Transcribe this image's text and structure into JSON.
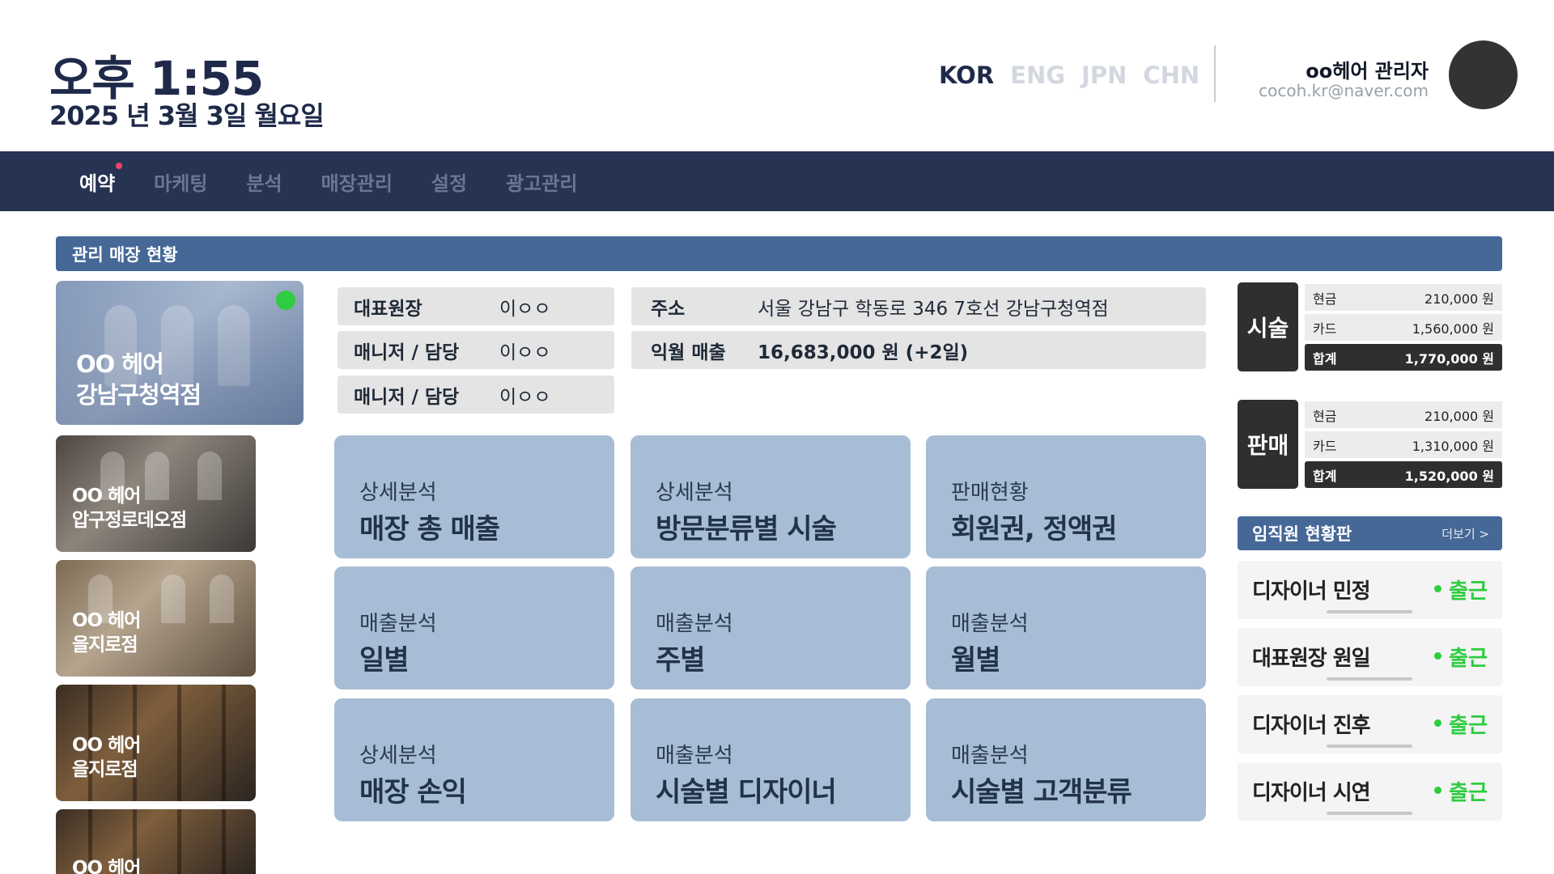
{
  "header": {
    "time": "오후 1:55",
    "date": "2025 년 3월 3일  월요일",
    "languages": [
      "KOR",
      "ENG",
      "JPN",
      "CHN"
    ],
    "admin_name": "oo헤어 관리자",
    "admin_email": "cocoh.kr@naver.com"
  },
  "nav": {
    "items": [
      "예약",
      "마케팅",
      "분석",
      "매장관리",
      "설정",
      "광고관리"
    ]
  },
  "section": {
    "title": "관리 매장 현황"
  },
  "stores": [
    {
      "line1": "OO 헤어",
      "line2": "강남구청역점"
    },
    {
      "line1": "OO 헤어",
      "line2": "압구정로데오점"
    },
    {
      "line1": "OO 헤어",
      "line2": "을지로점"
    },
    {
      "line1": "OO 헤어",
      "line2": "을지로점"
    },
    {
      "line1": "OO 헤어",
      "line2": ""
    }
  ],
  "info": {
    "rep_label": "대표원장",
    "rep_value": "이ㅇㅇ",
    "mgr1_label": "매니저 / 담당",
    "mgr1_value": "이ㅇㅇ",
    "mgr2_label": "매니저 / 담당",
    "mgr2_value": "이ㅇㅇ",
    "addr_label": "주소",
    "addr_value": "서울 강남구 학동로 346 7호선 강남구청역점",
    "sales_label": "익월 매출",
    "sales_value": "16,683,000 원 (+2일)"
  },
  "tiles": [
    {
      "sub": "상세분석",
      "main": "매장 총 매출"
    },
    {
      "sub": "상세분석",
      "main": "방문분류별 시술"
    },
    {
      "sub": "판매현황",
      "main": "회원권, 정액권"
    },
    {
      "sub": "매출분석",
      "main": "일별"
    },
    {
      "sub": "매출분석",
      "main": "주별"
    },
    {
      "sub": "매출분석",
      "main": "월별"
    },
    {
      "sub": "상세분석",
      "main": "매장 손익"
    },
    {
      "sub": "매출분석",
      "main": "시술별 디자이너"
    },
    {
      "sub": "매출분석",
      "main": "시술별 고객분류"
    }
  ],
  "sales": {
    "service": {
      "tag": "시술",
      "rows": [
        {
          "label": "현금",
          "amount": "210,000 원"
        },
        {
          "label": "카드",
          "amount": "1,560,000 원"
        },
        {
          "label": "합계",
          "amount": "1,770,000 원"
        }
      ]
    },
    "retail": {
      "tag": "판매",
      "rows": [
        {
          "label": "현금",
          "amount": "210,000 원"
        },
        {
          "label": "카드",
          "amount": "1,310,000 원"
        },
        {
          "label": "합계",
          "amount": "1,520,000 원"
        }
      ]
    }
  },
  "staff": {
    "title": "임직원 현황판",
    "more": "더보기 >",
    "members": [
      {
        "name": "디자이너 민정",
        "status": "출근"
      },
      {
        "name": "대표원장 원일",
        "status": "출근"
      },
      {
        "name": "디자이너 진후",
        "status": "출근"
      },
      {
        "name": "디자이너 시연",
        "status": "출근"
      }
    ]
  },
  "colors": {
    "navy": "#263352",
    "section_blue": "#456897",
    "tile_blue": "#a7bcd5",
    "status_green": "#2ecc40",
    "dark": "#2f2f2f"
  }
}
